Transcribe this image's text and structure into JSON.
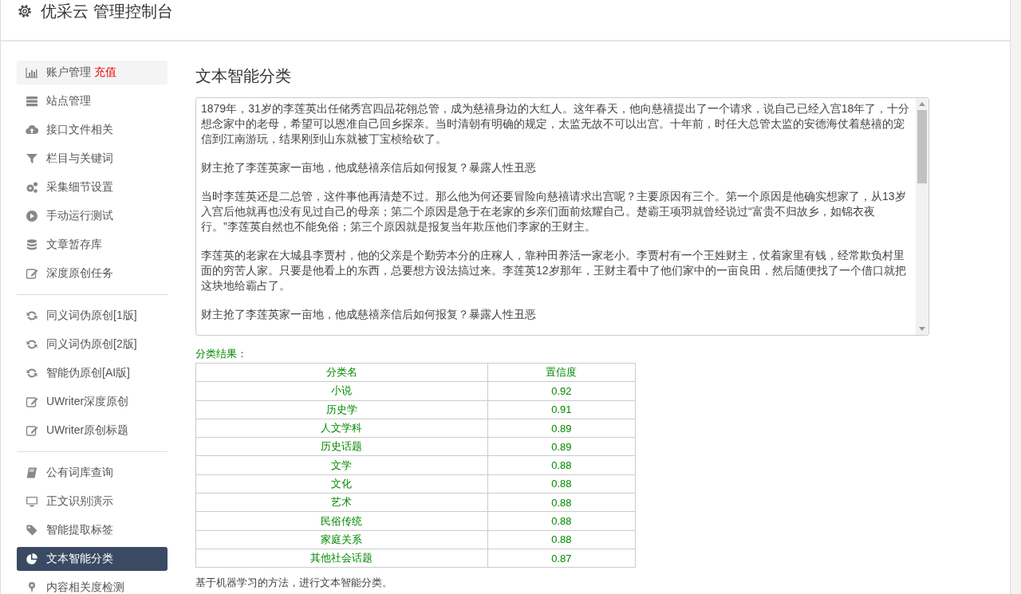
{
  "header": {
    "title": "优采云 管理控制台"
  },
  "sidebar": {
    "groups": [
      {
        "items": [
          {
            "label": "账户管理",
            "badge": "充值",
            "kind": "chart",
            "selected": false
          },
          {
            "label": "站点管理",
            "kind": "server",
            "selected": false
          },
          {
            "label": "接口文件相关",
            "kind": "cloud",
            "selected": false
          },
          {
            "label": "栏目与关键词",
            "kind": "filter",
            "selected": false
          },
          {
            "label": "采集细节设置",
            "kind": "gears",
            "selected": false
          },
          {
            "label": "手动运行测试",
            "kind": "play",
            "selected": false
          },
          {
            "label": "文章暂存库",
            "kind": "database",
            "selected": false
          },
          {
            "label": "深度原创任务",
            "kind": "edit",
            "selected": false
          }
        ]
      },
      {
        "items": [
          {
            "label": "同义词伪原创[1版]",
            "kind": "refresh",
            "selected": false
          },
          {
            "label": "同义词伪原创[2版]",
            "kind": "refresh",
            "selected": false
          },
          {
            "label": "智能伪原创[AI版]",
            "kind": "refresh",
            "selected": false
          },
          {
            "label": "UWriter深度原创",
            "kind": "edit",
            "selected": false
          },
          {
            "label": "UWriter原创标题",
            "kind": "edit",
            "selected": false
          }
        ]
      },
      {
        "items": [
          {
            "label": "公有词库查询",
            "kind": "book",
            "selected": false
          },
          {
            "label": "正文识别演示",
            "kind": "monitor",
            "selected": false
          },
          {
            "label": "智能提取标签",
            "kind": "tag",
            "selected": false
          },
          {
            "label": "文本智能分类",
            "kind": "pie",
            "selected": true
          },
          {
            "label": "内容相关度检测",
            "kind": "pin",
            "selected": false
          }
        ]
      }
    ]
  },
  "main": {
    "title": "文本智能分类",
    "text_input": {
      "paragraphs": [
        "1879年，31岁的李莲英出任储秀宫四品花翎总管，成为慈禧身边的大红人。这年春天，他向慈禧提出了一个请求，说自己已经入宫18年了，十分想念家中的老母，希望可以恩准自己回乡探亲。当时清朝有明确的规定，太监无故不可以出宫。十年前，时任大总管太监的安德海仗着慈禧的宠信到江南游玩，结果刚到山东就被丁宝桢给砍了。",
        "财主抢了李莲英家一亩地，他成慈禧亲信后如何报复？暴露人性丑恶",
        "当时李莲英还是二总管，这件事他再清楚不过。那么他为何还要冒险向慈禧请求出宫呢？主要原因有三个。第一个原因是他确实想家了，从13岁入宫后他就再也没有见过自己的母亲；第二个原因是急于在老家的乡亲们面前炫耀自己。楚霸王项羽就曾经说过“富贵不归故乡，如锦衣夜行。”李莲英自然也不能免俗；第三个原因就是报复当年欺压他们李家的王财主。",
        "李莲英的老家在大城县李贾村，他的父亲是个勤劳本分的庄稼人，靠种田养活一家老小。李贾村有一个王姓财主，仗着家里有钱，经常欺负村里面的穷苦人家。只要是他看上的东西，总要想方设法搞过来。李莲英12岁那年，王财主看中了他们家中的一亩良田，然后随便找了一个借口就把这块地给霸占了。",
        "财主抢了李莲英家一亩地，他成慈禧亲信后如何报复？暴露人性丑恶"
      ]
    },
    "result_label": "分类结果：",
    "table": {
      "columns": [
        "分类名",
        "置信度"
      ],
      "rows": [
        [
          "小说",
          "0.92"
        ],
        [
          "历史学",
          "0.91"
        ],
        [
          "人文学科",
          "0.89"
        ],
        [
          "历史话题",
          "0.89"
        ],
        [
          "文学",
          "0.88"
        ],
        [
          "文化",
          "0.88"
        ],
        [
          "艺术",
          "0.88"
        ],
        [
          "民俗传统",
          "0.88"
        ],
        [
          "家庭关系",
          "0.88"
        ],
        [
          "其他社会话题",
          "0.87"
        ]
      ]
    },
    "note": "基于机器学习的方法，进行文本智能分类。"
  }
}
